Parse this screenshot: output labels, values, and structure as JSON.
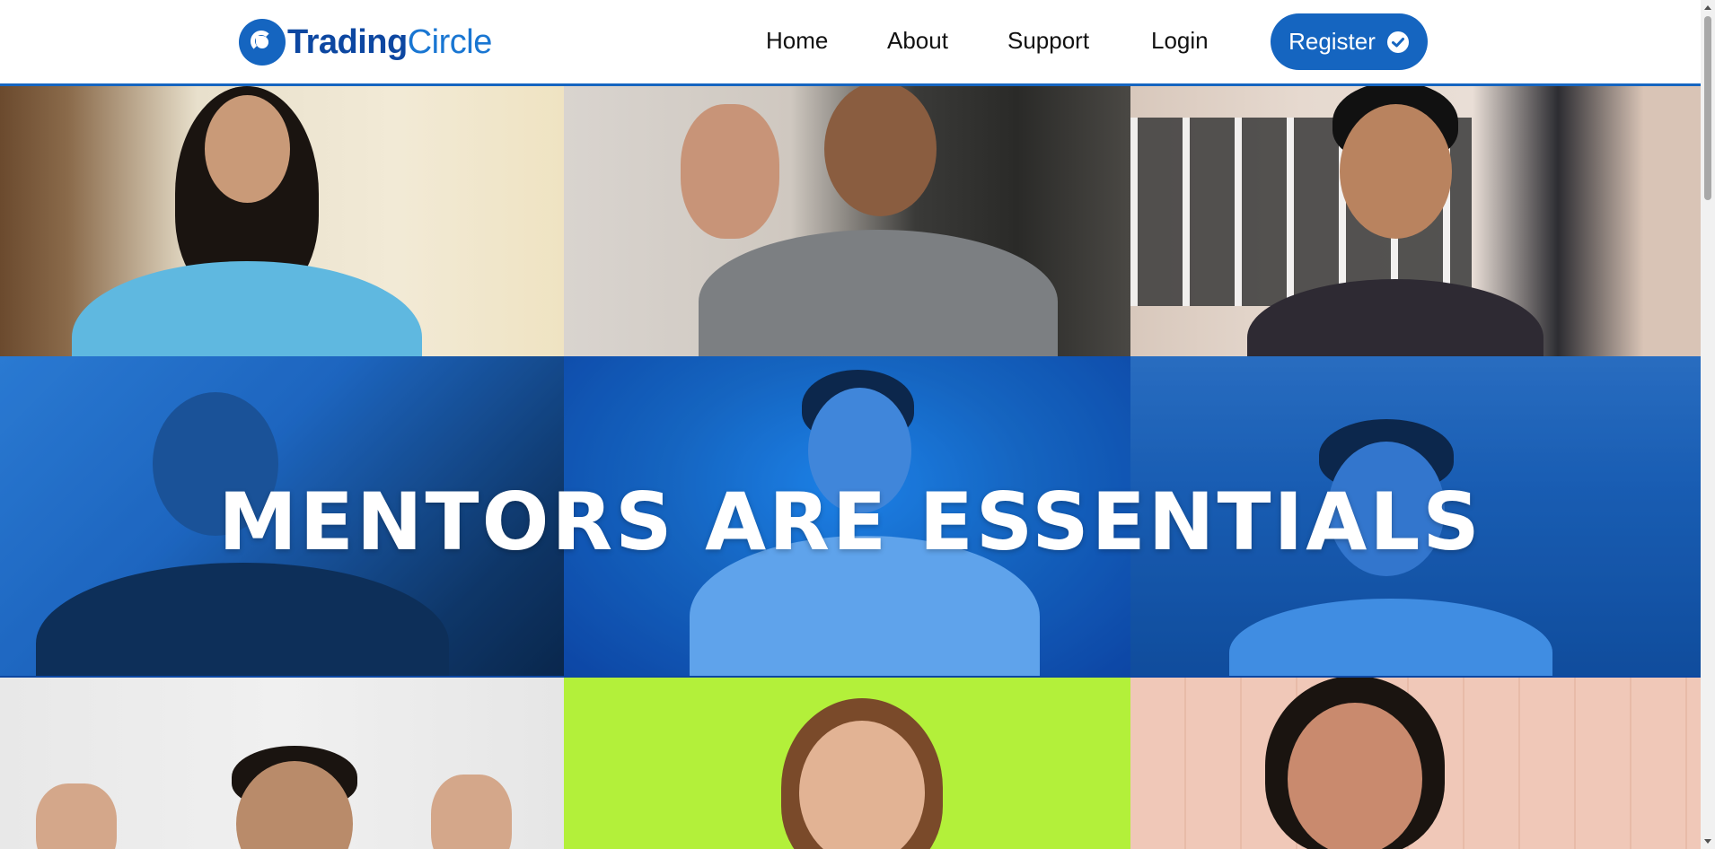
{
  "header": {
    "logo": {
      "part1": "Trading",
      "part2": "Circle"
    },
    "nav": [
      {
        "label": "Home"
      },
      {
        "label": "About"
      },
      {
        "label": "Support"
      },
      {
        "label": "Login"
      }
    ],
    "register_label": "Register",
    "register_icon": "check-circle-icon"
  },
  "hero": {
    "title": "MENTORS ARE ESSENTIALS",
    "overlay_color": "#1565c0"
  },
  "colors": {
    "brand_blue": "#1565c0",
    "brand_dark": "#0d47a1",
    "text_dark": "#111111"
  }
}
